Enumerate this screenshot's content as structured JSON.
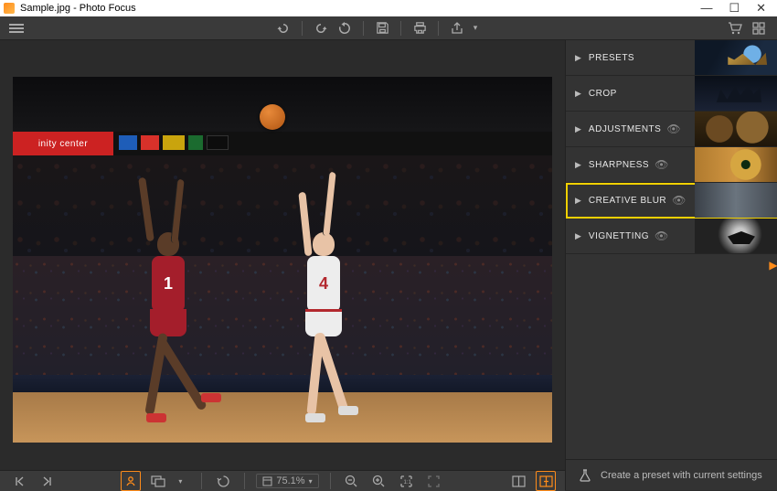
{
  "window": {
    "title": "Sample.jpg - Photo Focus",
    "minimize": "—",
    "maximize": "☐",
    "close": "✕"
  },
  "toolbar": {
    "cart": "cart",
    "grid": "grid"
  },
  "panels": {
    "items": [
      {
        "label": "PRESETS",
        "eye": false
      },
      {
        "label": "CROP",
        "eye": false
      },
      {
        "label": "ADJUSTMENTS",
        "eye": true
      },
      {
        "label": "SHARPNESS",
        "eye": true
      },
      {
        "label": "CREATIVE BLUR",
        "eye": true
      },
      {
        "label": "VIGNETTING",
        "eye": true
      }
    ]
  },
  "footer": {
    "preset_cta": "Create a preset with current settings"
  },
  "bottombar": {
    "zoom": "75.1%"
  },
  "photo": {
    "sign": "inity center",
    "p1_number": "1",
    "p2_number": "4"
  }
}
